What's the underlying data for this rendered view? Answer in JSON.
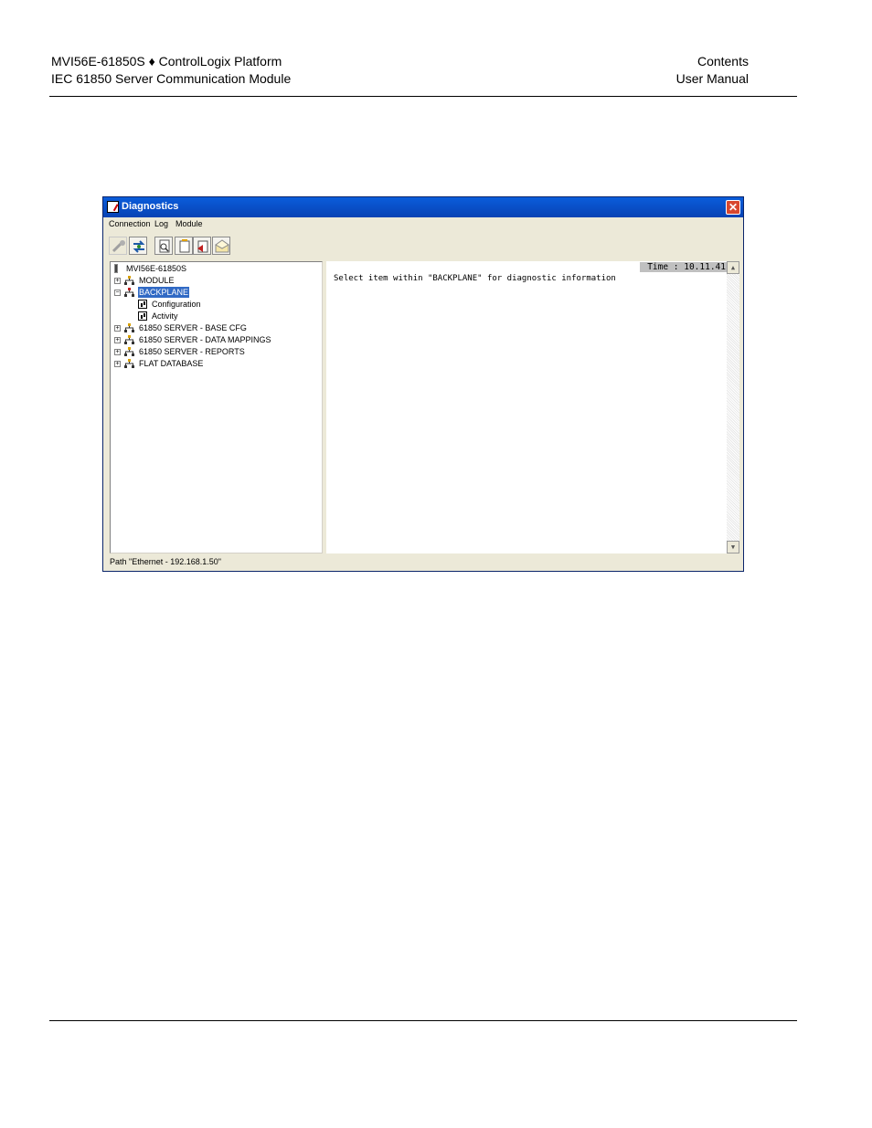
{
  "page_header": {
    "left_line1": "MVI56E-61850S ♦ ControlLogix Platform",
    "left_line2": "IEC 61850 Server Communication Module",
    "right_line1": "Contents",
    "right_line2": "User Manual"
  },
  "window": {
    "title": "Diagnostics",
    "close_glyph": "✕",
    "menu": [
      "Connection",
      "Log",
      "Module"
    ],
    "toolbar_icons": [
      "disconnect-icon",
      "connect-icon",
      "preview-icon",
      "new-log-icon",
      "open-log-icon",
      "email-icon"
    ],
    "tree": {
      "root": "MVI56E-61850S",
      "items": [
        {
          "label": "MODULE",
          "expander": "+"
        },
        {
          "label": "BACKPLANE",
          "expander": "−",
          "selected": true,
          "children": [
            "Configuration",
            "Activity"
          ]
        },
        {
          "label": "61850 SERVER - BASE CFG",
          "expander": "+"
        },
        {
          "label": "61850 SERVER - DATA MAPPINGS",
          "expander": "+"
        },
        {
          "label": "61850 SERVER - REPORTS",
          "expander": "+"
        },
        {
          "label": "FLAT DATABASE",
          "expander": "+"
        }
      ]
    },
    "output": {
      "time": "Time : 10.11.41",
      "message": "Select item within \"BACKPLANE\" for diagnostic information"
    },
    "status": "Path \"Ethernet - 192.168.1.50\""
  }
}
